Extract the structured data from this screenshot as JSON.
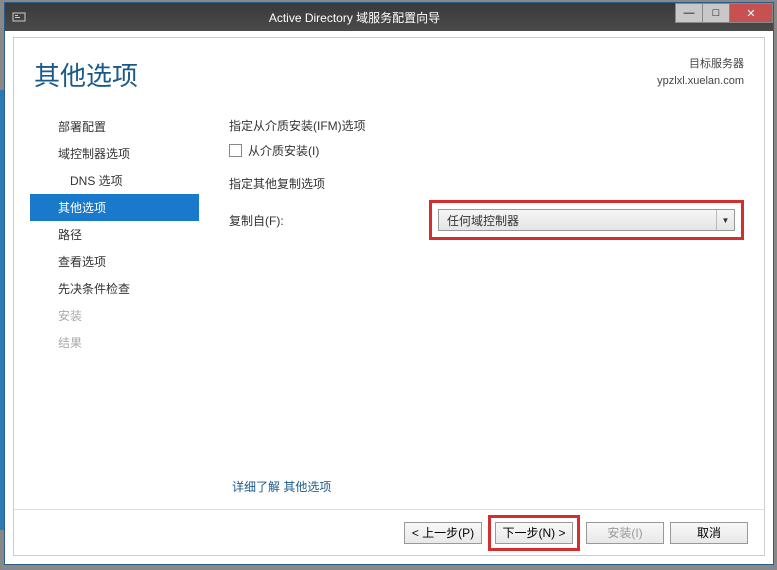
{
  "titlebar": {
    "title": "Active Directory 域服务配置向导"
  },
  "header": {
    "page_title": "其他选项",
    "target_label": "目标服务器",
    "target_server": "ypzlxl.xuelan.com"
  },
  "sidebar": {
    "items": [
      {
        "label": "部署配置",
        "level": 1,
        "active": false,
        "disabled": false
      },
      {
        "label": "域控制器选项",
        "level": 1,
        "active": false,
        "disabled": false
      },
      {
        "label": "DNS 选项",
        "level": 2,
        "active": false,
        "disabled": false
      },
      {
        "label": "其他选项",
        "level": 1,
        "active": true,
        "disabled": false
      },
      {
        "label": "路径",
        "level": 1,
        "active": false,
        "disabled": false
      },
      {
        "label": "查看选项",
        "level": 1,
        "active": false,
        "disabled": false
      },
      {
        "label": "先决条件检查",
        "level": 1,
        "active": false,
        "disabled": false
      },
      {
        "label": "安装",
        "level": 1,
        "active": false,
        "disabled": true
      },
      {
        "label": "结果",
        "level": 1,
        "active": false,
        "disabled": true
      }
    ]
  },
  "main": {
    "ifm_section_label": "指定从介质安装(IFM)选项",
    "ifm_checkbox_label": "从介质安装(I)",
    "replication_section_label": "指定其他复制选项",
    "replicate_from_label": "复制自(F):",
    "replicate_from_value": "任何域控制器",
    "more_link_prefix": "详细了解 ",
    "more_link_text": "其他选项"
  },
  "footer": {
    "prev": "< 上一步(P)",
    "next": "下一步(N) >",
    "install": "安装(I)",
    "cancel": "取消"
  }
}
